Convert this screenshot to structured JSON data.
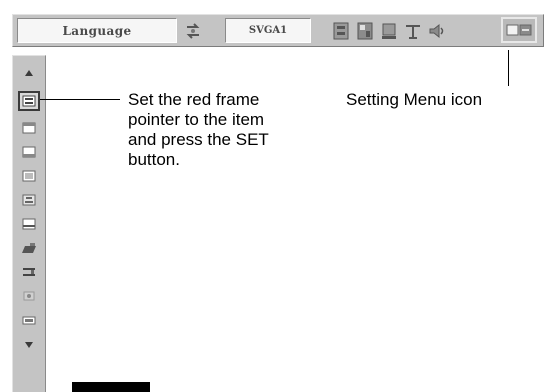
{
  "menubar": {
    "language_label": "Language",
    "display_mode": "SVGA1",
    "icons": [
      "swap-icon",
      "image-adjust-icon",
      "image-select-icon",
      "screen-icon",
      "pc-adjust-icon",
      "sound-icon",
      "setting-menu-icon"
    ]
  },
  "sidebar": {
    "icons": [
      "arrow-up-icon",
      "language-icon",
      "item-2-icon",
      "item-3-icon",
      "item-4-icon",
      "item-5-icon",
      "item-6-icon",
      "item-7-icon",
      "item-8-icon",
      "item-9-icon",
      "item-10-icon",
      "arrow-down-icon"
    ],
    "selected_index": 1
  },
  "annotations": {
    "instruction_lines": [
      "Set the red frame",
      "pointer to the item",
      "and press the SET",
      "button."
    ],
    "setting_menu_label": "Setting Menu icon"
  }
}
